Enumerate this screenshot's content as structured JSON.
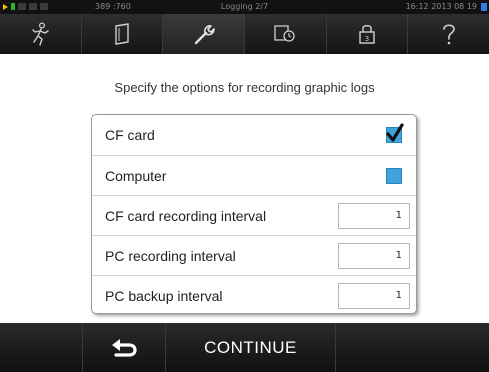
{
  "status_bar": {
    "counter": "389 :760",
    "title": "Logging 2/7",
    "datetime": "16:12  2013 08 19"
  },
  "toolbar": {
    "items": [
      {
        "icon": "running-man-icon"
      },
      {
        "icon": "panel-icon"
      },
      {
        "icon": "wrench-icon",
        "active": true
      },
      {
        "icon": "screen-timer-icon"
      },
      {
        "icon": "lock-icon"
      },
      {
        "icon": "question-mark-icon"
      }
    ]
  },
  "main": {
    "heading": "Specify the options for recording graphic logs",
    "options": [
      {
        "label": "CF card",
        "type": "checkbox",
        "checked": true
      },
      {
        "label": "Computer",
        "type": "checkbox",
        "checked": false
      },
      {
        "label": "CF card recording interval",
        "type": "number",
        "value": "1"
      },
      {
        "label": "PC recording interval",
        "type": "number",
        "value": "1"
      },
      {
        "label": "PC backup interval",
        "type": "number",
        "value": "1"
      }
    ]
  },
  "bottom_bar": {
    "continue_label": "CONTINUE"
  },
  "colors": {
    "checkbox": "#3fa3dd",
    "toolbar": "#1e1e1e",
    "status_play": "#f2c200",
    "status_battery": "#2f7de0"
  }
}
